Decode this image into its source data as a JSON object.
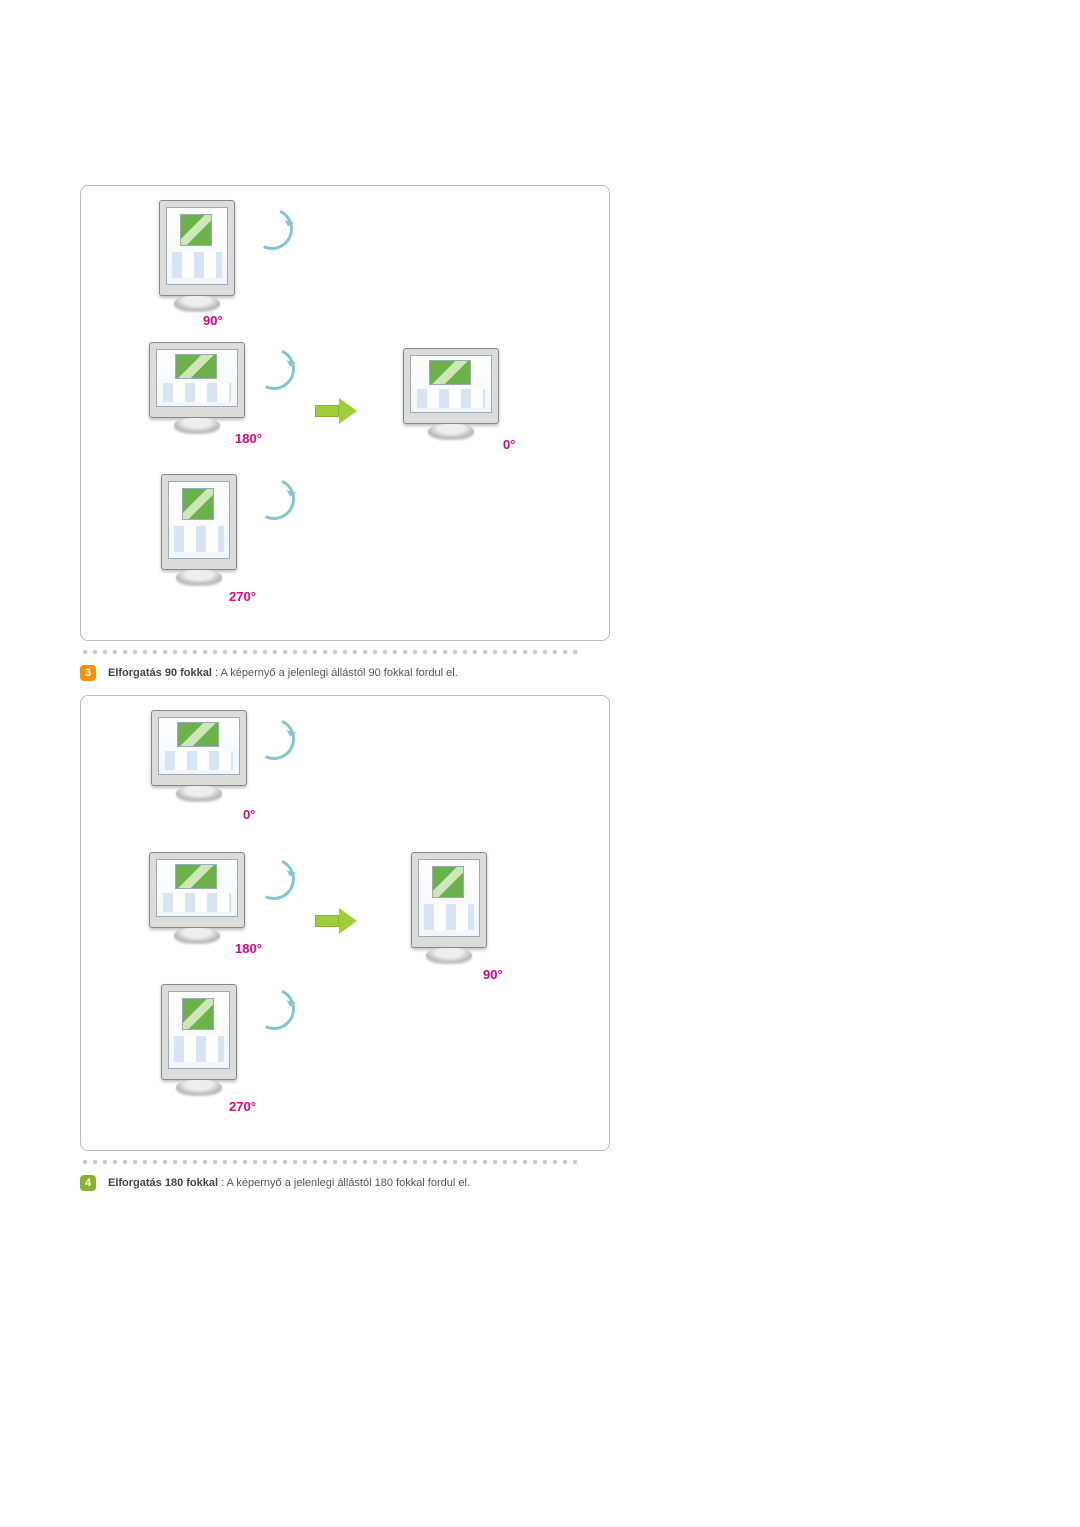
{
  "illustration_labels": {
    "top": {
      "deg90": "90°",
      "deg180": "180°",
      "deg0": "0°",
      "deg270": "270°"
    },
    "bottom": {
      "deg0": "0°",
      "deg180": "180°",
      "deg90": "90°",
      "deg270": "270°"
    }
  },
  "steps": {
    "s3": {
      "number": "3",
      "title": "Elforgatás 90 fokkal",
      "sep": " : ",
      "text": "A képernyő a jelenlegi állástól 90 fokkal fordul el."
    },
    "s4": {
      "number": "4",
      "title": "Elforgatás 180 fokkal",
      "sep": " : ",
      "text": "A képernyő a jelenlegi állástól 180 fokkal fordul el."
    }
  }
}
